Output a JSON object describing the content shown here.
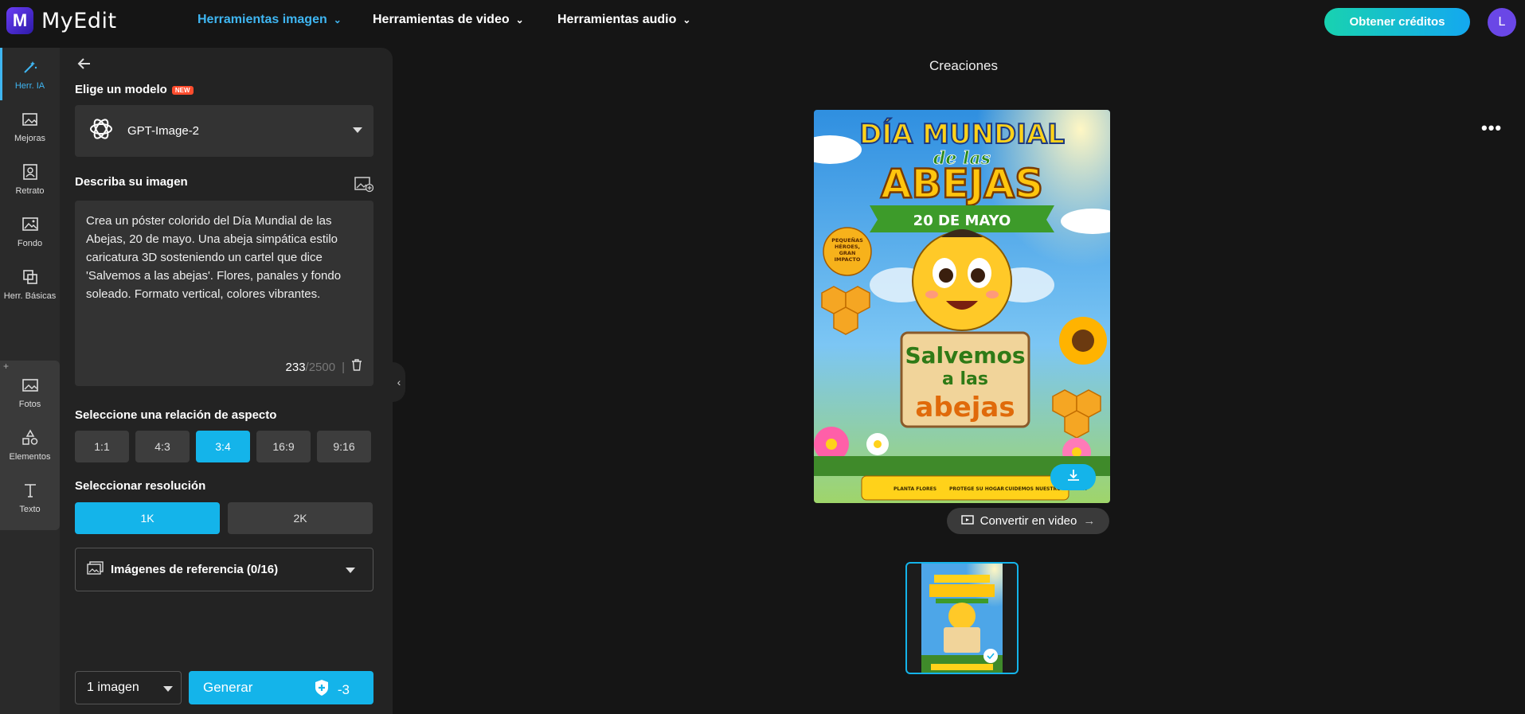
{
  "app": {
    "name": "MyEdit",
    "logo_letter": "M"
  },
  "nav": {
    "items": [
      {
        "label": "Herramientas imagen",
        "active": true
      },
      {
        "label": "Herramientas de video",
        "active": false
      },
      {
        "label": "Herramientas audio",
        "active": false
      }
    ],
    "credits_button": "Obtener créditos",
    "avatar_letter": "L"
  },
  "rail": {
    "items": [
      {
        "label": "Herr. IA",
        "icon": "magic-wand-icon",
        "active": true
      },
      {
        "label": "Mejoras",
        "icon": "image-enhance-icon"
      },
      {
        "label": "Retrato",
        "icon": "portrait-icon"
      },
      {
        "label": "Fondo",
        "icon": "background-icon"
      },
      {
        "label": "Herr. Básicas",
        "icon": "crop-icon"
      },
      {
        "label": "Fotos",
        "icon": "photos-icon"
      },
      {
        "label": "Elementos",
        "icon": "shapes-icon"
      },
      {
        "label": "Texto",
        "icon": "text-icon"
      }
    ]
  },
  "panel": {
    "model_label": "Elige un modelo",
    "new_badge": "NEW",
    "model_name": "GPT-Image-2",
    "prompt_label": "Describa su imagen",
    "prompt_text": "Crea un póster colorido del Día Mundial de las Abejas, 20 de mayo. Una abeja simpática estilo caricatura 3D sosteniendo un cartel que dice 'Salvemos a las abejas'. Flores, panales y fondo soleado. Formato vertical, colores vibrantes.",
    "char_count": "233",
    "char_max": "/2500",
    "char_sep": "|",
    "ratio_label": "Seleccione una relación de aspecto",
    "ratios": [
      "1:1",
      "4:3",
      "3:4",
      "16:9",
      "9:16"
    ],
    "ratio_selected": "3:4",
    "resolution_label": "Seleccionar resolución",
    "resolutions": [
      "1K",
      "2K"
    ],
    "resolution_selected": "1K",
    "reference_label": "Imágenes de referencia (0/16)",
    "count_select": "1 imagen",
    "generate_label": "Generar",
    "generate_cost": "-3"
  },
  "main": {
    "title": "Creaciones",
    "convert_label": "Convertir en video",
    "more_label": "•••"
  },
  "poster": {
    "line1": "DÍA MUNDIAL",
    "line2": "de las",
    "line3": "ABEJAS",
    "date": "20 DE MAYO",
    "badge": "PEQUEÑAS HÉROES, GRAN IMPACTO",
    "sign1": "Salvemos",
    "sign2": "a las",
    "sign3": "abejas",
    "foot1": "PLANTA FLORES",
    "foot2": "PROTEGE SU HOGAR",
    "foot3": "CUIDEMOS NUESTRO PLANETA"
  },
  "colors": {
    "accent": "#14b4ea",
    "nav_active": "#3fb6f2",
    "panel_bg": "#232323",
    "page_bg": "#151515"
  }
}
